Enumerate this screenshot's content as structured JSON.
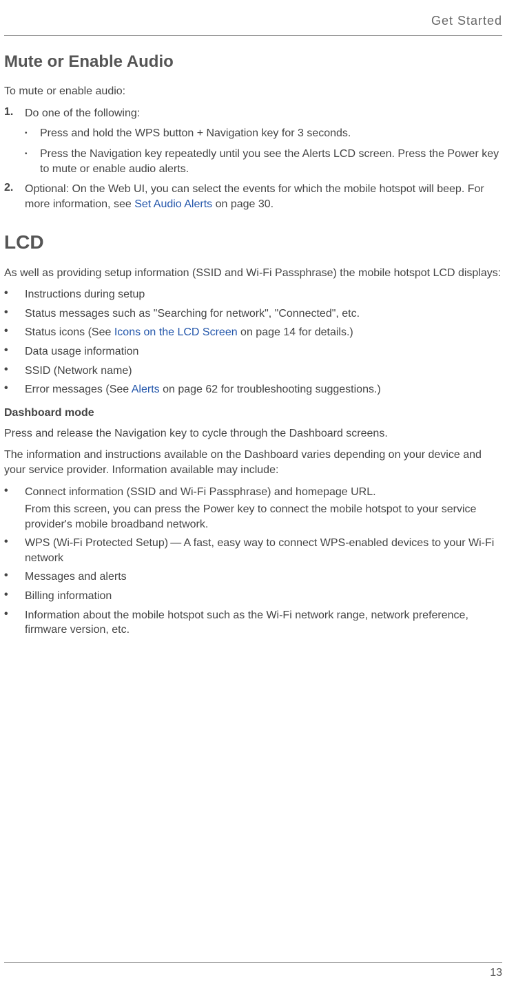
{
  "header": "Get Started",
  "section1": {
    "title": "Mute or Enable Audio",
    "intro": "To mute or enable audio:",
    "step1_num": "1.",
    "step1_text": "Do one of the following:",
    "step1_sub1": "Press and hold the WPS button + Navigation key for 3 seconds.",
    "step1_sub2": "Press the Navigation key repeatedly until you see the Alerts LCD screen. Press the Power key to mute or enable audio alerts.",
    "step2_num": "2.",
    "step2_text_before": "Optional: On the Web UI, you can select the events for which the mobile hotspot will beep. For more information, see ",
    "step2_link": "Set Audio Alerts",
    "step2_text_after": " on page 30."
  },
  "section2": {
    "title": "LCD",
    "intro": "As well as providing setup information (SSID and Wi-Fi Passphrase) the mobile hotspot LCD displays:",
    "b1": "Instructions during setup",
    "b2": "Status messages such as \"Searching for network\", \"Connected\", etc.",
    "b3_before": "Status icons (See ",
    "b3_link": "Icons on the LCD Screen",
    "b3_after": " on page 14 for details.)",
    "b4": "Data usage information",
    "b5": "SSID (Network name)",
    "b6_before": "Error messages (See ",
    "b6_link": "Alerts",
    "b6_after": " on page 62 for troubleshooting suggestions.)",
    "sub_heading": "Dashboard mode",
    "sub_p1": "Press and release the Navigation key to cycle through the Dashboard screens.",
    "sub_p2": "The information and instructions available on the Dashboard varies depending on your device and your service provider. Information available may include:",
    "db1_line1": "Connect information (SSID and Wi-Fi Passphrase) and homepage URL.",
    "db1_line2": "From this screen, you can press the Power key to connect the mobile hotspot to your service provider's mobile broadband network.",
    "db2": "WPS (Wi-Fi Protected Setup) — A fast, easy way to connect WPS-enabled devices to your Wi-Fi network",
    "db3": "Messages and alerts",
    "db4": "Billing information",
    "db5": "Information about the mobile hotspot such as the Wi-Fi network range, network preference, firmware version, etc."
  },
  "page_number": "13"
}
